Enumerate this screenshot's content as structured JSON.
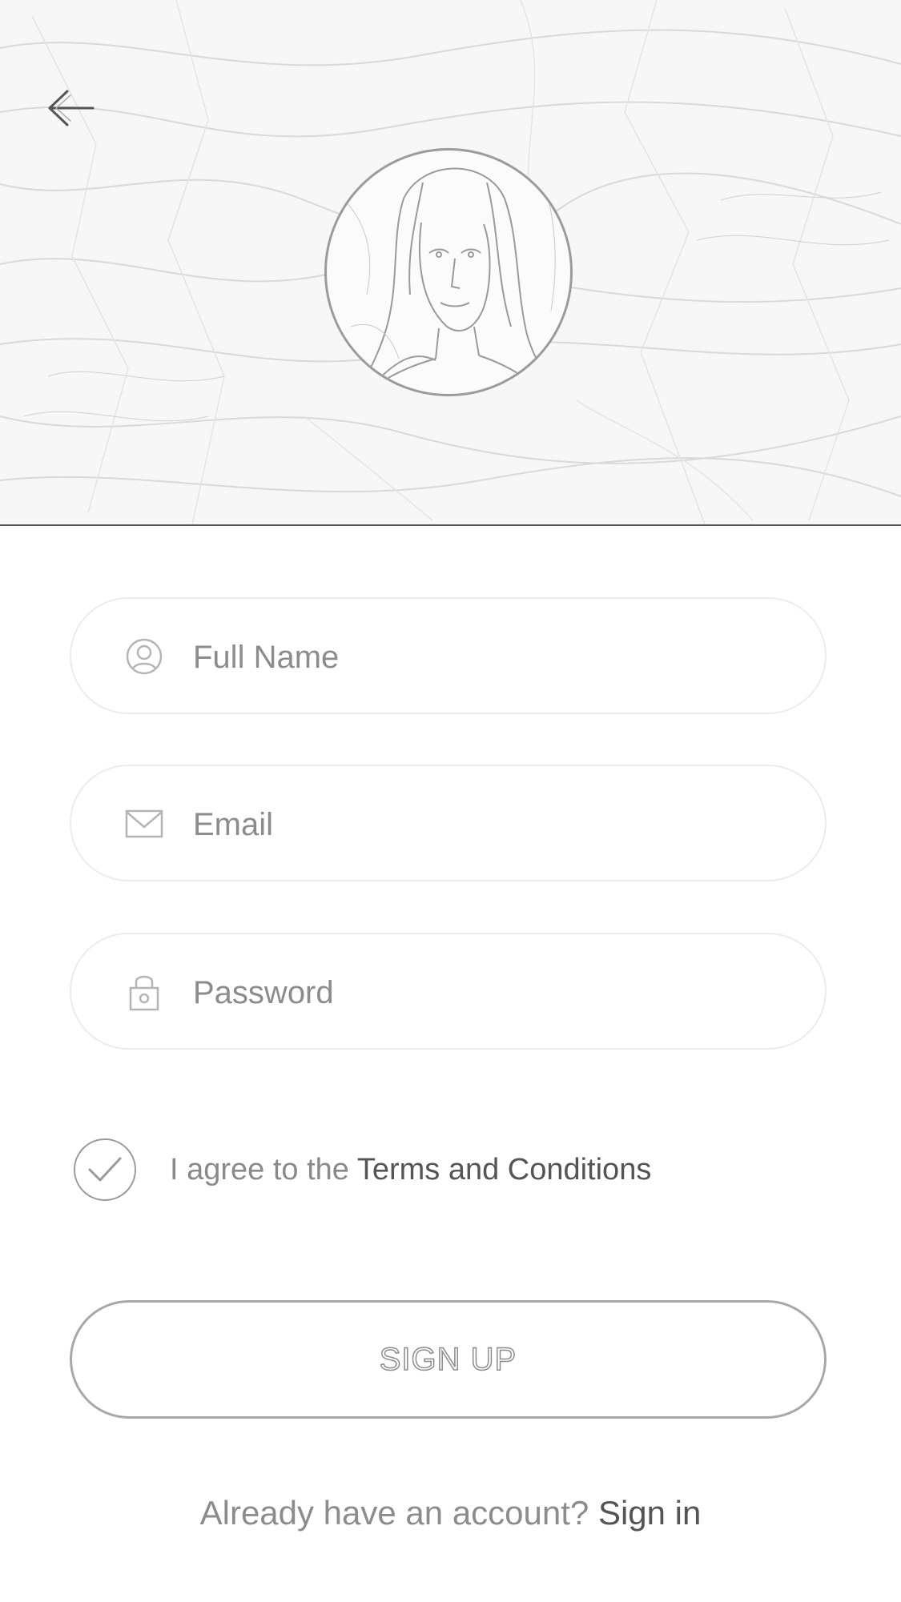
{
  "header": {
    "back_icon": "arrow-left-icon",
    "avatar": "profile-photo"
  },
  "form": {
    "full_name": {
      "placeholder": "Full Name",
      "value": "",
      "icon": "user-icon"
    },
    "email": {
      "placeholder": "Email",
      "value": "",
      "icon": "envelope-icon"
    },
    "password": {
      "placeholder": "Password",
      "value": "",
      "icon": "lock-icon"
    }
  },
  "terms": {
    "checked": true,
    "prefix": "I agree to the ",
    "link_label": "Terms and Conditions"
  },
  "signup_button": {
    "label": "SIGN UP"
  },
  "footer": {
    "prompt": "Already have an account? ",
    "link_label": "Sign in"
  }
}
